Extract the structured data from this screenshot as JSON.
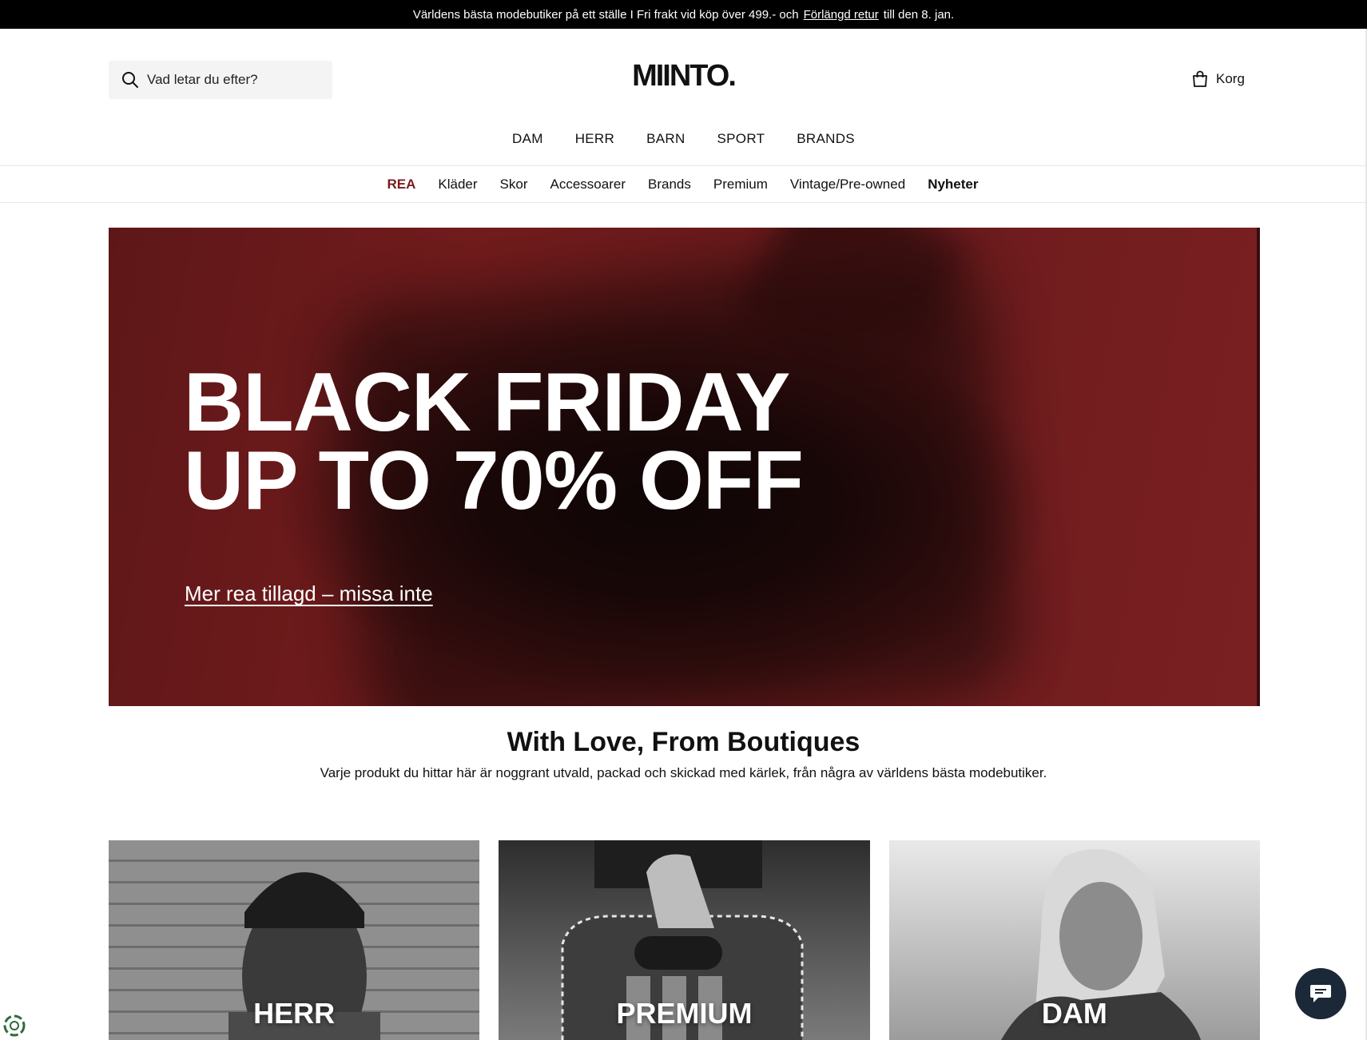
{
  "announcement": {
    "text_before": "Världens bästa modebutiker på ett ställe I Fri frakt vid köp över 499.- och",
    "link": "Förlängd retur",
    "text_after": "till den 8. jan."
  },
  "header": {
    "search_placeholder": "Vad letar du efter?",
    "logo": "MIINTO.",
    "cart_label": "Korg"
  },
  "main_nav": [
    "DAM",
    "HERR",
    "BARN",
    "SPORT",
    "BRANDS"
  ],
  "sub_nav": [
    "REA",
    "Kläder",
    "Skor",
    "Accessoarer",
    "Brands",
    "Premium",
    "Vintage/Pre-owned",
    "Nyheter"
  ],
  "hero": {
    "line1": "BLACK FRIDAY",
    "line2": "UP TO 70% OFF",
    "cta": "Mer rea tillagd – missa inte"
  },
  "intro": {
    "title": "With Love, From Boutiques",
    "text": "Varje produkt du hittar här är noggrant utvald, packad och skickad med kärlek, från några av världens bästa modebutiker."
  },
  "tiles": [
    "HERR",
    "PREMIUM",
    "DAM"
  ],
  "colors": {
    "announcement_bg": "#000000",
    "sale": "#7a1b1e",
    "hero_bg": "#6b1a1b",
    "chat_button": "#1b2838"
  },
  "icons": [
    "search-icon",
    "bag-icon",
    "chat-icon",
    "eco-badge-icon"
  ]
}
